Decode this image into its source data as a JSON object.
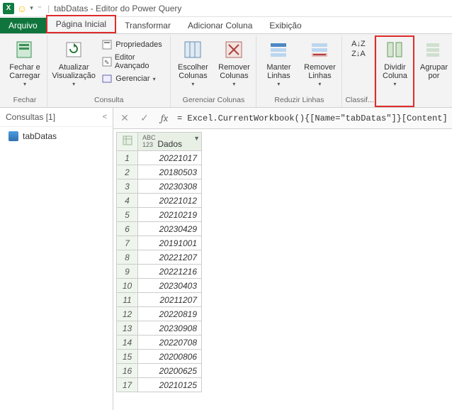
{
  "titlebar": {
    "app_title": "tabDatas - Editor do Power Query"
  },
  "tabs": {
    "file": "Arquivo",
    "home": "Página Inicial",
    "transform": "Transformar",
    "add_column": "Adicionar Coluna",
    "view": "Exibição"
  },
  "ribbon": {
    "close_load": "Fechar e Carregar",
    "close_group": "Fechar",
    "refresh": "Atualizar Visualização",
    "properties": "Propriedades",
    "advanced_editor": "Editor Avançado",
    "manage": "Gerenciar",
    "consulta_group": "Consulta",
    "choose_cols": "Escolher Colunas",
    "remove_cols": "Remover Colunas",
    "manage_cols_group": "Gerenciar Colunas",
    "keep_rows": "Manter Linhas",
    "remove_rows": "Remover Linhas",
    "reduce_rows_group": "Reduzir Linhas",
    "sort_group": "Classif...",
    "split_col": "Dividir Coluna",
    "group_by": "Agrupar por"
  },
  "queries": {
    "header": "Consultas [1]",
    "item": "tabDatas"
  },
  "formula": "= Excel.CurrentWorkbook(){[Name=\"tabDatas\"]}[Content]",
  "grid": {
    "col_header": "Dados",
    "type_label": "ABC 123",
    "rows": [
      "20221017",
      "20180503",
      "20230308",
      "20221012",
      "20210219",
      "20230429",
      "20191001",
      "20221207",
      "20221216",
      "20230403",
      "20211207",
      "20220819",
      "20230908",
      "20220708",
      "20200806",
      "20200625",
      "20210125"
    ]
  }
}
